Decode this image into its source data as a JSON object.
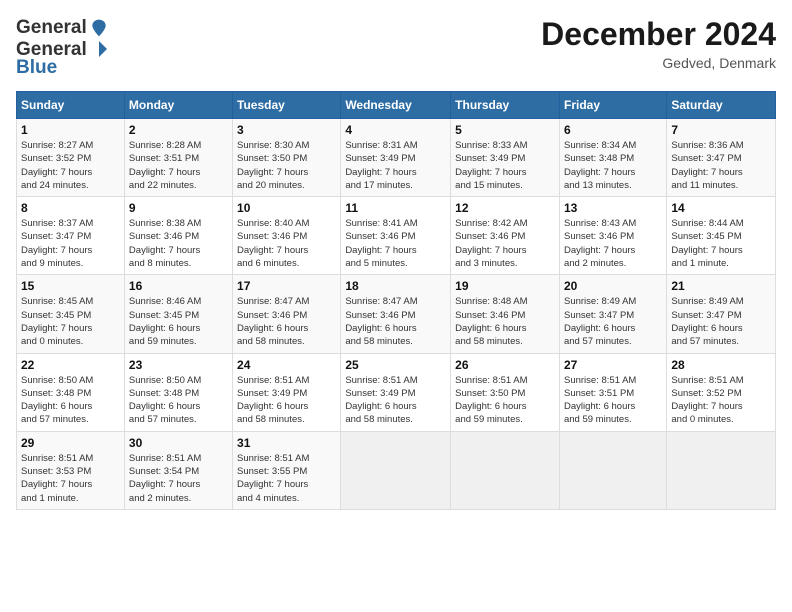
{
  "header": {
    "logo_general": "General",
    "logo_blue": "Blue",
    "month_title": "December 2024",
    "subtitle": "Gedved, Denmark"
  },
  "days_of_week": [
    "Sunday",
    "Monday",
    "Tuesday",
    "Wednesday",
    "Thursday",
    "Friday",
    "Saturday"
  ],
  "weeks": [
    [
      {
        "day": "1",
        "info": "Sunrise: 8:27 AM\nSunset: 3:52 PM\nDaylight: 7 hours\nand 24 minutes."
      },
      {
        "day": "2",
        "info": "Sunrise: 8:28 AM\nSunset: 3:51 PM\nDaylight: 7 hours\nand 22 minutes."
      },
      {
        "day": "3",
        "info": "Sunrise: 8:30 AM\nSunset: 3:50 PM\nDaylight: 7 hours\nand 20 minutes."
      },
      {
        "day": "4",
        "info": "Sunrise: 8:31 AM\nSunset: 3:49 PM\nDaylight: 7 hours\nand 17 minutes."
      },
      {
        "day": "5",
        "info": "Sunrise: 8:33 AM\nSunset: 3:49 PM\nDaylight: 7 hours\nand 15 minutes."
      },
      {
        "day": "6",
        "info": "Sunrise: 8:34 AM\nSunset: 3:48 PM\nDaylight: 7 hours\nand 13 minutes."
      },
      {
        "day": "7",
        "info": "Sunrise: 8:36 AM\nSunset: 3:47 PM\nDaylight: 7 hours\nand 11 minutes."
      }
    ],
    [
      {
        "day": "8",
        "info": "Sunrise: 8:37 AM\nSunset: 3:47 PM\nDaylight: 7 hours\nand 9 minutes."
      },
      {
        "day": "9",
        "info": "Sunrise: 8:38 AM\nSunset: 3:46 PM\nDaylight: 7 hours\nand 8 minutes."
      },
      {
        "day": "10",
        "info": "Sunrise: 8:40 AM\nSunset: 3:46 PM\nDaylight: 7 hours\nand 6 minutes."
      },
      {
        "day": "11",
        "info": "Sunrise: 8:41 AM\nSunset: 3:46 PM\nDaylight: 7 hours\nand 5 minutes."
      },
      {
        "day": "12",
        "info": "Sunrise: 8:42 AM\nSunset: 3:46 PM\nDaylight: 7 hours\nand 3 minutes."
      },
      {
        "day": "13",
        "info": "Sunrise: 8:43 AM\nSunset: 3:46 PM\nDaylight: 7 hours\nand 2 minutes."
      },
      {
        "day": "14",
        "info": "Sunrise: 8:44 AM\nSunset: 3:45 PM\nDaylight: 7 hours\nand 1 minute."
      }
    ],
    [
      {
        "day": "15",
        "info": "Sunrise: 8:45 AM\nSunset: 3:45 PM\nDaylight: 7 hours\nand 0 minutes."
      },
      {
        "day": "16",
        "info": "Sunrise: 8:46 AM\nSunset: 3:45 PM\nDaylight: 6 hours\nand 59 minutes."
      },
      {
        "day": "17",
        "info": "Sunrise: 8:47 AM\nSunset: 3:46 PM\nDaylight: 6 hours\nand 58 minutes."
      },
      {
        "day": "18",
        "info": "Sunrise: 8:47 AM\nSunset: 3:46 PM\nDaylight: 6 hours\nand 58 minutes."
      },
      {
        "day": "19",
        "info": "Sunrise: 8:48 AM\nSunset: 3:46 PM\nDaylight: 6 hours\nand 58 minutes."
      },
      {
        "day": "20",
        "info": "Sunrise: 8:49 AM\nSunset: 3:47 PM\nDaylight: 6 hours\nand 57 minutes."
      },
      {
        "day": "21",
        "info": "Sunrise: 8:49 AM\nSunset: 3:47 PM\nDaylight: 6 hours\nand 57 minutes."
      }
    ],
    [
      {
        "day": "22",
        "info": "Sunrise: 8:50 AM\nSunset: 3:48 PM\nDaylight: 6 hours\nand 57 minutes."
      },
      {
        "day": "23",
        "info": "Sunrise: 8:50 AM\nSunset: 3:48 PM\nDaylight: 6 hours\nand 57 minutes."
      },
      {
        "day": "24",
        "info": "Sunrise: 8:51 AM\nSunset: 3:49 PM\nDaylight: 6 hours\nand 58 minutes."
      },
      {
        "day": "25",
        "info": "Sunrise: 8:51 AM\nSunset: 3:49 PM\nDaylight: 6 hours\nand 58 minutes."
      },
      {
        "day": "26",
        "info": "Sunrise: 8:51 AM\nSunset: 3:50 PM\nDaylight: 6 hours\nand 59 minutes."
      },
      {
        "day": "27",
        "info": "Sunrise: 8:51 AM\nSunset: 3:51 PM\nDaylight: 6 hours\nand 59 minutes."
      },
      {
        "day": "28",
        "info": "Sunrise: 8:51 AM\nSunset: 3:52 PM\nDaylight: 7 hours\nand 0 minutes."
      }
    ],
    [
      {
        "day": "29",
        "info": "Sunrise: 8:51 AM\nSunset: 3:53 PM\nDaylight: 7 hours\nand 1 minute."
      },
      {
        "day": "30",
        "info": "Sunrise: 8:51 AM\nSunset: 3:54 PM\nDaylight: 7 hours\nand 2 minutes."
      },
      {
        "day": "31",
        "info": "Sunrise: 8:51 AM\nSunset: 3:55 PM\nDaylight: 7 hours\nand 4 minutes."
      },
      {
        "day": "",
        "info": ""
      },
      {
        "day": "",
        "info": ""
      },
      {
        "day": "",
        "info": ""
      },
      {
        "day": "",
        "info": ""
      }
    ]
  ]
}
